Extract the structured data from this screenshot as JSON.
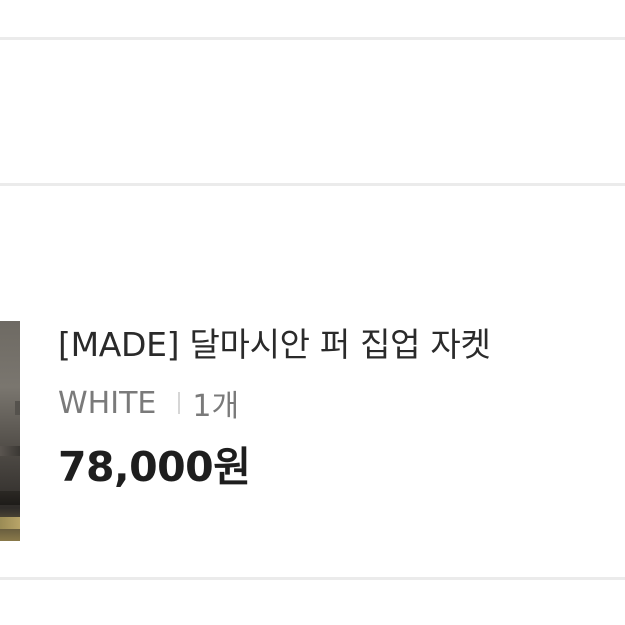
{
  "product": {
    "title": "[MADE] 달마시안 퍼 집업 자켓",
    "option_color": "WHITE",
    "quantity": "1개",
    "price": "78,000원"
  },
  "colors": {
    "divider": "#ebebeb",
    "title_text": "#2a2a2a",
    "option_text": "#7a7a7a",
    "price_text": "#1e1e1e"
  }
}
